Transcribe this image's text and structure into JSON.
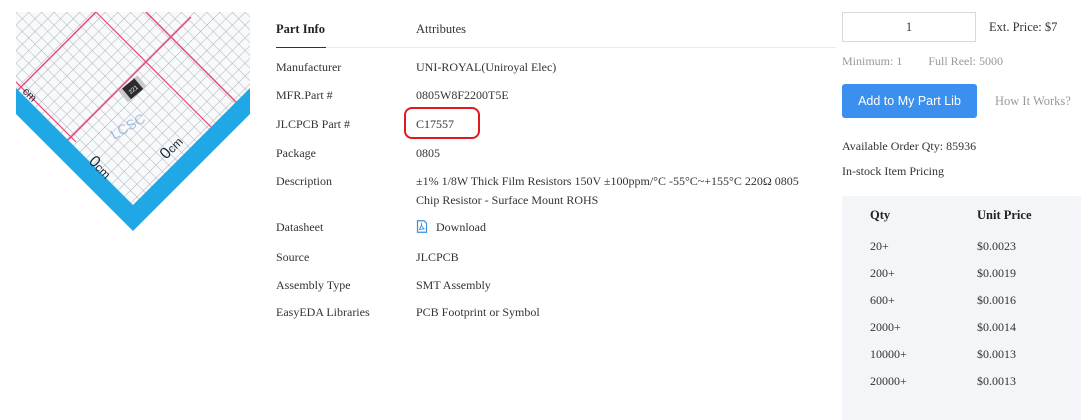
{
  "tabs": {
    "part_info": "Part Info",
    "attributes": "Attributes"
  },
  "rows": [
    {
      "label": "Manufacturer",
      "value": "UNI-ROYAL(Uniroyal Elec)"
    },
    {
      "label": "MFR.Part #",
      "value": "0805W8F2200T5E"
    },
    {
      "label": "JLCPCB Part #",
      "value": "C17557"
    },
    {
      "label": "Package",
      "value": "0805"
    },
    {
      "label": "Description",
      "value": "±1% 1/8W Thick Film Resistors 150V ±100ppm/°C -55°C~+155°C 220Ω 0805",
      "value2": "Chip Resistor - Surface Mount ROHS"
    },
    {
      "label": "Datasheet",
      "value": "Download"
    },
    {
      "label": "Source",
      "value": "JLCPCB"
    },
    {
      "label": "Assembly Type",
      "value": "SMT Assembly"
    },
    {
      "label": "EasyEDA Libraries",
      "value": "PCB Footprint or Symbol"
    }
  ],
  "image": {
    "resistor_marking": "221",
    "scale_label_cm": "cm",
    "scale_zero": "0",
    "watermark": "LCSC"
  },
  "order": {
    "quantity": "1",
    "ext_price": "Ext. Price: $7",
    "minimum": "Minimum:  1",
    "full_reel": "Full Reel:  5000",
    "add_button": "Add to My Part Lib",
    "how_it_works": "How It Works?",
    "available": "Available Order Qty: 85936",
    "instock_pricing": "In-stock Item Pricing"
  },
  "price_table": {
    "headers": {
      "qty": "Qty",
      "unit_price": "Unit Price"
    },
    "rows": [
      {
        "qty": "20+",
        "price": "$0.0023"
      },
      {
        "qty": "200+",
        "price": "$0.0019"
      },
      {
        "qty": "600+",
        "price": "$0.0016"
      },
      {
        "qty": "2000+",
        "price": "$0.0014"
      },
      {
        "qty": "10000+",
        "price": "$0.0013"
      },
      {
        "qty": "20000+",
        "price": "$0.0013"
      }
    ]
  },
  "colors": {
    "accent": "#3b8fee",
    "link": "#3b8fd9",
    "highlight": "#e0191e",
    "price_bg": "#f3f5f8"
  }
}
